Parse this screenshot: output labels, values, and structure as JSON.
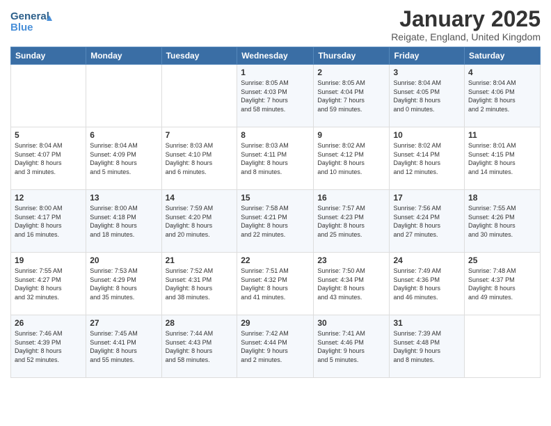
{
  "logo": {
    "general": "General",
    "blue": "Blue"
  },
  "header": {
    "title": "January 2025",
    "location": "Reigate, England, United Kingdom"
  },
  "weekdays": [
    "Sunday",
    "Monday",
    "Tuesday",
    "Wednesday",
    "Thursday",
    "Friday",
    "Saturday"
  ],
  "weeks": [
    [
      {
        "day": "",
        "info": ""
      },
      {
        "day": "",
        "info": ""
      },
      {
        "day": "",
        "info": ""
      },
      {
        "day": "1",
        "info": "Sunrise: 8:05 AM\nSunset: 4:03 PM\nDaylight: 7 hours\nand 58 minutes."
      },
      {
        "day": "2",
        "info": "Sunrise: 8:05 AM\nSunset: 4:04 PM\nDaylight: 7 hours\nand 59 minutes."
      },
      {
        "day": "3",
        "info": "Sunrise: 8:04 AM\nSunset: 4:05 PM\nDaylight: 8 hours\nand 0 minutes."
      },
      {
        "day": "4",
        "info": "Sunrise: 8:04 AM\nSunset: 4:06 PM\nDaylight: 8 hours\nand 2 minutes."
      }
    ],
    [
      {
        "day": "5",
        "info": "Sunrise: 8:04 AM\nSunset: 4:07 PM\nDaylight: 8 hours\nand 3 minutes."
      },
      {
        "day": "6",
        "info": "Sunrise: 8:04 AM\nSunset: 4:09 PM\nDaylight: 8 hours\nand 5 minutes."
      },
      {
        "day": "7",
        "info": "Sunrise: 8:03 AM\nSunset: 4:10 PM\nDaylight: 8 hours\nand 6 minutes."
      },
      {
        "day": "8",
        "info": "Sunrise: 8:03 AM\nSunset: 4:11 PM\nDaylight: 8 hours\nand 8 minutes."
      },
      {
        "day": "9",
        "info": "Sunrise: 8:02 AM\nSunset: 4:12 PM\nDaylight: 8 hours\nand 10 minutes."
      },
      {
        "day": "10",
        "info": "Sunrise: 8:02 AM\nSunset: 4:14 PM\nDaylight: 8 hours\nand 12 minutes."
      },
      {
        "day": "11",
        "info": "Sunrise: 8:01 AM\nSunset: 4:15 PM\nDaylight: 8 hours\nand 14 minutes."
      }
    ],
    [
      {
        "day": "12",
        "info": "Sunrise: 8:00 AM\nSunset: 4:17 PM\nDaylight: 8 hours\nand 16 minutes."
      },
      {
        "day": "13",
        "info": "Sunrise: 8:00 AM\nSunset: 4:18 PM\nDaylight: 8 hours\nand 18 minutes."
      },
      {
        "day": "14",
        "info": "Sunrise: 7:59 AM\nSunset: 4:20 PM\nDaylight: 8 hours\nand 20 minutes."
      },
      {
        "day": "15",
        "info": "Sunrise: 7:58 AM\nSunset: 4:21 PM\nDaylight: 8 hours\nand 22 minutes."
      },
      {
        "day": "16",
        "info": "Sunrise: 7:57 AM\nSunset: 4:23 PM\nDaylight: 8 hours\nand 25 minutes."
      },
      {
        "day": "17",
        "info": "Sunrise: 7:56 AM\nSunset: 4:24 PM\nDaylight: 8 hours\nand 27 minutes."
      },
      {
        "day": "18",
        "info": "Sunrise: 7:55 AM\nSunset: 4:26 PM\nDaylight: 8 hours\nand 30 minutes."
      }
    ],
    [
      {
        "day": "19",
        "info": "Sunrise: 7:55 AM\nSunset: 4:27 PM\nDaylight: 8 hours\nand 32 minutes."
      },
      {
        "day": "20",
        "info": "Sunrise: 7:53 AM\nSunset: 4:29 PM\nDaylight: 8 hours\nand 35 minutes."
      },
      {
        "day": "21",
        "info": "Sunrise: 7:52 AM\nSunset: 4:31 PM\nDaylight: 8 hours\nand 38 minutes."
      },
      {
        "day": "22",
        "info": "Sunrise: 7:51 AM\nSunset: 4:32 PM\nDaylight: 8 hours\nand 41 minutes."
      },
      {
        "day": "23",
        "info": "Sunrise: 7:50 AM\nSunset: 4:34 PM\nDaylight: 8 hours\nand 43 minutes."
      },
      {
        "day": "24",
        "info": "Sunrise: 7:49 AM\nSunset: 4:36 PM\nDaylight: 8 hours\nand 46 minutes."
      },
      {
        "day": "25",
        "info": "Sunrise: 7:48 AM\nSunset: 4:37 PM\nDaylight: 8 hours\nand 49 minutes."
      }
    ],
    [
      {
        "day": "26",
        "info": "Sunrise: 7:46 AM\nSunset: 4:39 PM\nDaylight: 8 hours\nand 52 minutes."
      },
      {
        "day": "27",
        "info": "Sunrise: 7:45 AM\nSunset: 4:41 PM\nDaylight: 8 hours\nand 55 minutes."
      },
      {
        "day": "28",
        "info": "Sunrise: 7:44 AM\nSunset: 4:43 PM\nDaylight: 8 hours\nand 58 minutes."
      },
      {
        "day": "29",
        "info": "Sunrise: 7:42 AM\nSunset: 4:44 PM\nDaylight: 9 hours\nand 2 minutes."
      },
      {
        "day": "30",
        "info": "Sunrise: 7:41 AM\nSunset: 4:46 PM\nDaylight: 9 hours\nand 5 minutes."
      },
      {
        "day": "31",
        "info": "Sunrise: 7:39 AM\nSunset: 4:48 PM\nDaylight: 9 hours\nand 8 minutes."
      },
      {
        "day": "",
        "info": ""
      }
    ]
  ]
}
